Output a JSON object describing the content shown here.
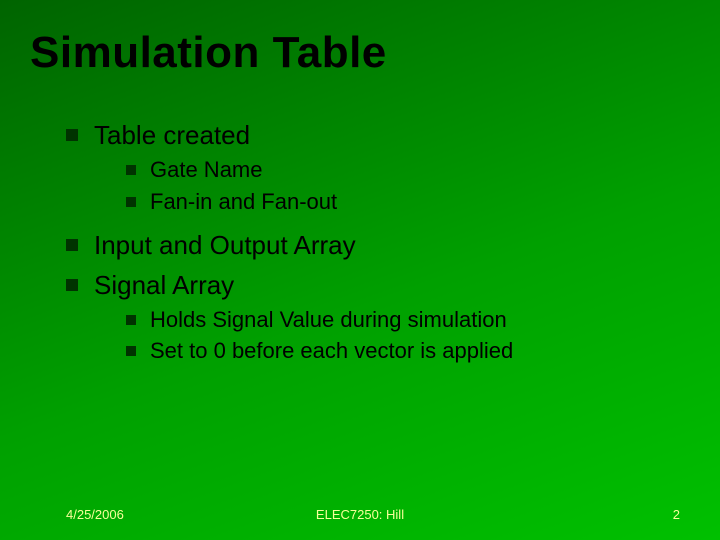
{
  "title": "Simulation Table",
  "bullets": {
    "b1": "Table created",
    "b1_sub1": "Gate Name",
    "b1_sub2": "Fan-in and Fan-out",
    "b2": "Input and Output Array",
    "b3": "Signal Array",
    "b3_sub1": "Holds Signal Value during simulation",
    "b3_sub2": "Set to 0 before each vector is applied"
  },
  "footer": {
    "date": "4/25/2006",
    "center": "ELEC7250: Hill",
    "page": "2"
  }
}
